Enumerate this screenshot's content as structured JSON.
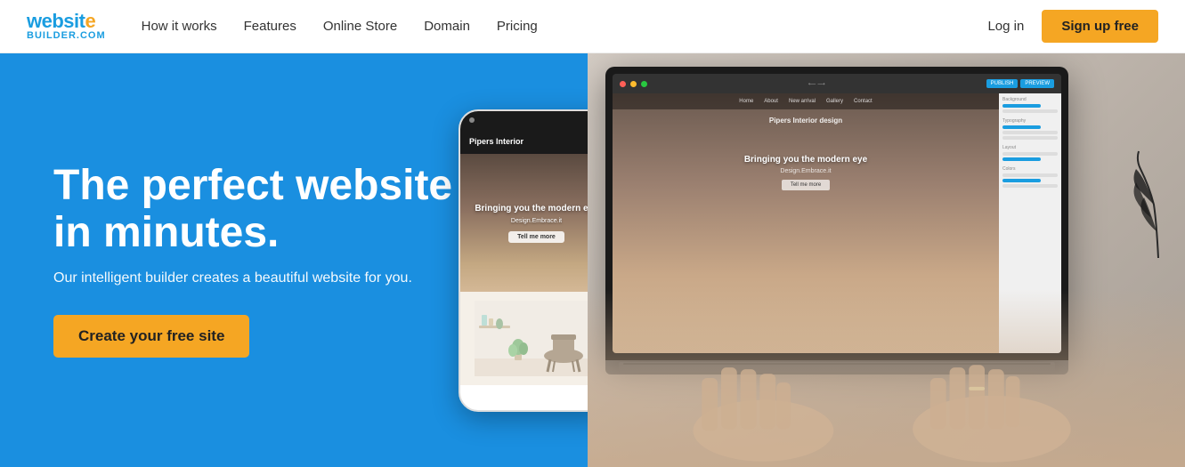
{
  "brand": {
    "name_website": "websit",
    "name_dot": "e",
    "name_builder": "BUILDER.COM",
    "logo_dot_char": "·"
  },
  "nav": {
    "links": [
      {
        "label": "How it works",
        "id": "how-it-works"
      },
      {
        "label": "Features",
        "id": "features"
      },
      {
        "label": "Online Store",
        "id": "online-store"
      },
      {
        "label": "Domain",
        "id": "domain"
      },
      {
        "label": "Pricing",
        "id": "pricing"
      }
    ],
    "login_label": "Log in",
    "signup_label": "Sign up free"
  },
  "hero": {
    "title_line1": "The perfect website",
    "title_line2": "in minutes.",
    "subtitle": "Our intelligent builder creates a beautiful website for you.",
    "cta_label": "Create your free site"
  },
  "phone_mockup": {
    "brand": "Pipers Interior",
    "headline": "Bringing you the modern eye",
    "subtext": "Design.Embrace.it",
    "button": "Tell me more"
  },
  "laptop_mockup": {
    "site_title": "Pipers Interior design",
    "site_headline": "Bringing you the modern eye",
    "site_sub": "Design.Embrace.it",
    "nav_items": [
      "Home",
      "About",
      "New arrival",
      "Gallery",
      "Contact"
    ]
  },
  "colors": {
    "hero_bg": "#1a8fe0",
    "cta_orange": "#f5a623",
    "nav_bg": "#ffffff",
    "text_dark": "#333333",
    "text_white": "#ffffff"
  }
}
